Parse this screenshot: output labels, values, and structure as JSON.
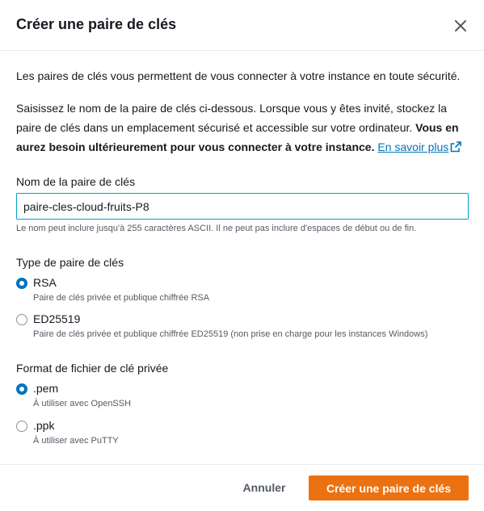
{
  "dialog": {
    "title": "Créer une paire de clés"
  },
  "intro": "Les paires de clés vous permettent de vous connecter à votre instance en toute sécurité.",
  "instructions": {
    "line1": "Saisissez le nom de la paire de clés ci-dessous. Lorsque vous y êtes invité, stockez la",
    "line2_plain": "paire de clés dans un emplacement sécurisé et accessible sur votre ordinateur. ",
    "line2_bold": "Vous en",
    "line3_bold": "aurez besoin ultérieurement pour vous connecter à votre instance.",
    "link": "En savoir plus"
  },
  "name_field": {
    "label": "Nom de la paire de clés",
    "value": "paire-cles-cloud-fruits-P8",
    "hint": "Le nom peut inclure jusqu'à 255 caractères ASCII. Il ne peut pas inclure d'espaces de début ou de fin."
  },
  "key_type": {
    "label": "Type de paire de clés",
    "options": [
      {
        "label": "RSA",
        "desc": "Paire de clés privée et publique chiffrée RSA",
        "selected": true
      },
      {
        "label": "ED25519",
        "desc": "Paire de clés privée et publique chiffrée ED25519 (non prise en charge pour les instances Windows)",
        "selected": false
      }
    ]
  },
  "file_format": {
    "label": "Format de fichier de clé privée",
    "options": [
      {
        "label": ".pem",
        "desc": "À utiliser avec OpenSSH",
        "selected": true
      },
      {
        "label": ".ppk",
        "desc": "À utiliser avec PuTTY",
        "selected": false
      }
    ]
  },
  "footer": {
    "cancel_label": "Annuler",
    "create_label": "Créer une paire de clés"
  },
  "colors": {
    "accent_blue": "#0073bb",
    "primary_orange": "#ec7211",
    "input_focus": "#00a1c9"
  },
  "icons": {
    "close": "close-icon",
    "external_link": "external-link-icon"
  }
}
